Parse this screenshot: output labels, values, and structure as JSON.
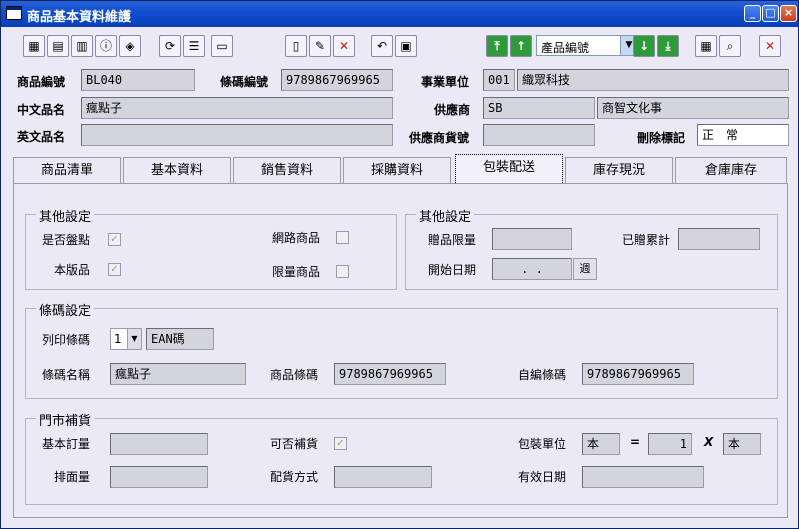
{
  "window": {
    "title": "商品基本資料維護"
  },
  "toolbar": {
    "product_code_combo": "產品編號"
  },
  "header": {
    "product_code": {
      "label": "商品編號",
      "value": "BL040"
    },
    "barcode": {
      "label": "條碼編號",
      "value": "9789867969965"
    },
    "business_unit": {
      "label": "事業單位",
      "code": "001",
      "name": "織眾科技"
    },
    "chinese_name": {
      "label": "中文品名",
      "value": "瘋點子"
    },
    "supplier": {
      "label": "供應商",
      "code": "SB",
      "name": "商智文化事"
    },
    "english_name": {
      "label": "英文品名",
      "value": ""
    },
    "supplier_item_no": {
      "label": "供應商貨號",
      "value": ""
    },
    "delete_flag": {
      "label": "刪除標記",
      "value": "正　常"
    }
  },
  "tabs": [
    {
      "label": "商品清單"
    },
    {
      "label": "基本資料"
    },
    {
      "label": "銷售資料"
    },
    {
      "label": "採購資料"
    },
    {
      "label": "包裝配送"
    },
    {
      "label": "庫存現況"
    },
    {
      "label": "倉庫庫存"
    }
  ],
  "other_settings_left": {
    "title": "其他設定",
    "is_discount_label": "是否盤點",
    "is_discount_checked": true,
    "own_version_label": "本版品",
    "own_version_checked": true,
    "online_product_label": "網路商品",
    "online_product_checked": false,
    "limited_product_label": "限量商品",
    "limited_product_checked": false
  },
  "other_settings_right": {
    "title": "其他設定",
    "gift_limit_label": "贈品限量",
    "gift_limit_value": "",
    "gift_total_label": "已贈累計",
    "gift_total_value": "",
    "start_date_label": "開始日期",
    "start_date_value": ". .",
    "date_button": "週"
  },
  "barcode_settings": {
    "title": "條碼設定",
    "print_barcode_label": "列印條碼",
    "print_barcode_value": "1",
    "barcode_type": "EAN碼",
    "barcode_name_label": "條碼名稱",
    "barcode_name_value": "瘋點子",
    "product_barcode_label": "商品條碼",
    "product_barcode_value": "9789867969965",
    "custom_barcode_label": "自編條碼",
    "custom_barcode_value": "9789867969965"
  },
  "store_replenishment": {
    "title": "門市補貨",
    "base_order_label": "基本訂量",
    "base_order_value": "",
    "replenishable_label": "可否補貨",
    "replenishable_checked": true,
    "pack_unit_label": "包裝單位",
    "pack_unit_left": "本",
    "equals": "=",
    "pack_qty": "1",
    "times": "X",
    "pack_unit_right": "本",
    "face_qty_label": "排面量",
    "face_qty_value": "",
    "distribution_label": "配貨方式",
    "distribution_value": "",
    "expiry_label": "有效日期",
    "expiry_value": ""
  }
}
